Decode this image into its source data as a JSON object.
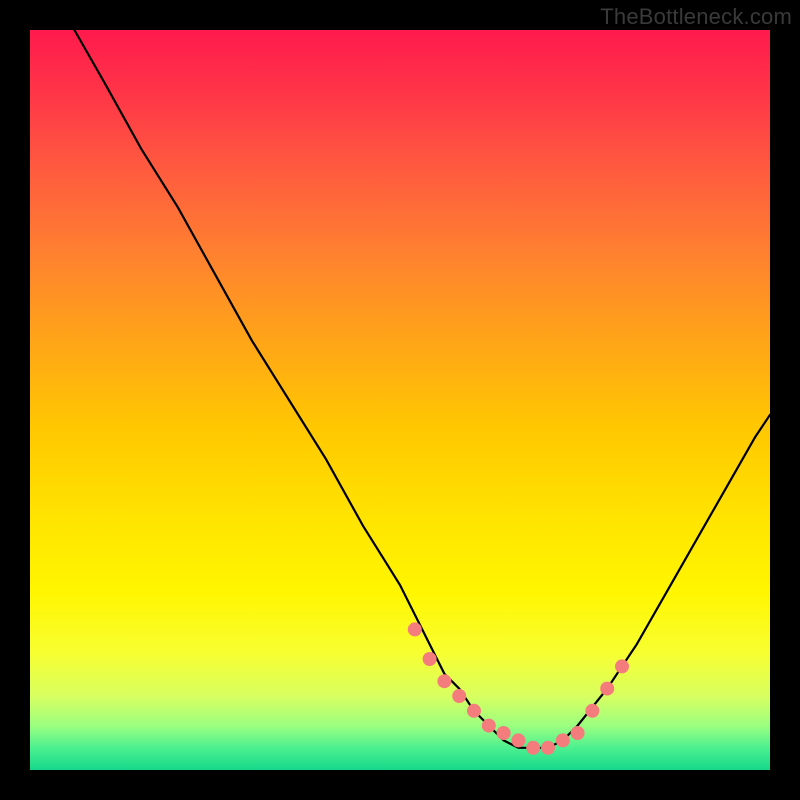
{
  "watermark": "TheBottleneck.com",
  "chart_data": {
    "type": "line",
    "title": "",
    "xlabel": "",
    "ylabel": "",
    "xlim": [
      0,
      100
    ],
    "ylim": [
      0,
      100
    ],
    "series": [
      {
        "name": "bottleneck-curve",
        "x": [
          6,
          10,
          15,
          20,
          25,
          30,
          35,
          40,
          45,
          50,
          53,
          56,
          58,
          60,
          62,
          64,
          66,
          68,
          70,
          72,
          74,
          78,
          82,
          86,
          90,
          94,
          98,
          100
        ],
        "values": [
          100,
          93,
          84,
          76,
          67,
          58,
          50,
          42,
          33,
          25,
          19,
          13,
          11,
          8,
          6,
          4,
          3,
          3,
          3,
          4,
          6,
          11,
          17,
          24,
          31,
          38,
          45,
          48
        ]
      }
    ],
    "markers": {
      "name": "sample-dots",
      "color": "#f47c7c",
      "radius": 7,
      "x": [
        52,
        54,
        56,
        58,
        60,
        62,
        64,
        66,
        68,
        70,
        72,
        74,
        76,
        78,
        80
      ],
      "values": [
        19,
        15,
        12,
        10,
        8,
        6,
        5,
        4,
        3,
        3,
        4,
        5,
        8,
        11,
        14
      ]
    }
  }
}
